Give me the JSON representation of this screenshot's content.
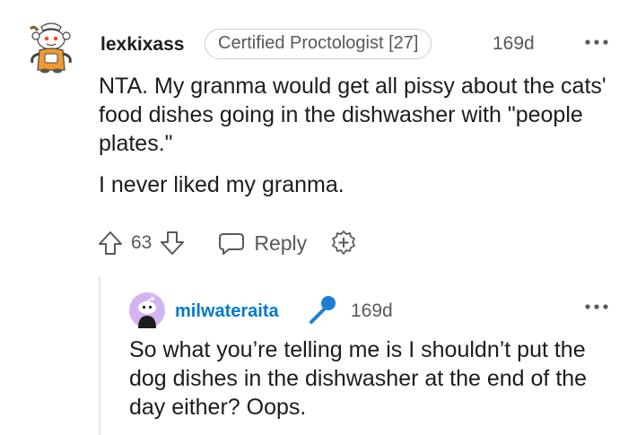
{
  "comment": {
    "username": "lexkixass",
    "flair": "Certified Proctologist [27]",
    "time": "169d",
    "paragraphs": [
      "NTA. My granma would get all pissy about the cats' food dishes going in the dishwasher with \"people plates.\"",
      "I never liked my granma."
    ],
    "score": "63",
    "reply_label": "Reply",
    "icons": {
      "avatar": "snoo-avatar",
      "more": "more-options-icon",
      "upvote": "upvote-arrow-icon",
      "downvote": "downvote-arrow-icon",
      "reply": "speech-bubble-icon",
      "award": "award-plus-icon"
    }
  },
  "reply": {
    "username": "milwateraita",
    "time": "169d",
    "text": "So what you’re telling me is I shouldn’t put the dog dishes in the dishwasher at the end of the day either? Oops.",
    "icons": {
      "avatar": "snoo-avatar",
      "badge": "microphone-icon",
      "more": "more-options-icon"
    }
  },
  "colors": {
    "text": "#1c1c1c",
    "meta": "#555a5e",
    "link_blue": "#0079d3",
    "avatar_purple": "#d4b4f0"
  }
}
